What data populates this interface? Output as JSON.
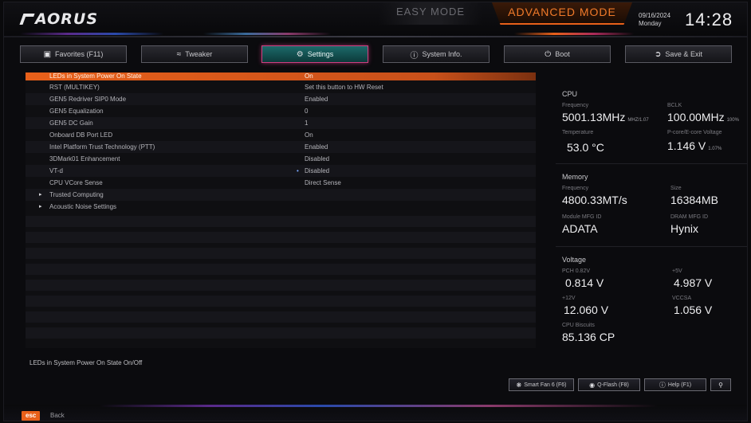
{
  "header": {
    "logo_text": "AORUS",
    "easy_mode": "EASY MODE",
    "advanced_mode": "ADVANCED MODE",
    "date": "09/16/2024",
    "day": "Monday",
    "time": "14:28"
  },
  "tabs": [
    {
      "label": "Favorites (F11)",
      "icon": "star-folder-icon"
    },
    {
      "label": "Tweaker",
      "icon": "tweaker-icon"
    },
    {
      "label": "Settings",
      "icon": "settings-gear-icon",
      "active": true
    },
    {
      "label": "System Info.",
      "icon": "info-icon"
    },
    {
      "label": "Boot",
      "icon": "power-icon"
    },
    {
      "label": "Save & Exit",
      "icon": "exit-arrow-icon"
    }
  ],
  "settings": [
    {
      "name": "LEDs in System Power On State",
      "value": "On",
      "selected": true
    },
    {
      "name": "RST (MULTIKEY)",
      "value": "Set this button to HW Reset"
    },
    {
      "name": "GEN5 Redriver SIP0 Mode",
      "value": "Enabled"
    },
    {
      "name": "GEN5 Equalization",
      "value": "0"
    },
    {
      "name": "GEN5 DC Gain",
      "value": "1"
    },
    {
      "name": "Onboard DB Port LED",
      "value": "On"
    },
    {
      "name": "Intel Platform Trust Technology (PTT)",
      "value": "Enabled"
    },
    {
      "name": "3DMark01 Enhancement",
      "value": "Disabled"
    },
    {
      "name": "VT-d",
      "value": "Disabled",
      "marker": "•"
    },
    {
      "name": "CPU VCore Sense",
      "value": "Direct Sense"
    },
    {
      "name": "Trusted Computing",
      "value": "",
      "submenu": "▸"
    },
    {
      "name": "Acoustic Noise Settings",
      "value": "",
      "submenu": "▸"
    }
  ],
  "help_text": "LEDs in System Power On State On/Off",
  "panel": {
    "cpu": {
      "title": "CPU",
      "freq_label": "Frequency",
      "freq": "5001.13MHz",
      "freq_unit": "MHZ/1.07",
      "bclk_label": "BCLK",
      "bclk": "100.00MHz",
      "bclk_unit": "100%",
      "temp_label": "Temperature",
      "temp": "53.0 °C",
      "volt_label": "P-core/E-core Voltage",
      "volt": "1.146 V",
      "volt_unit": "1.07%"
    },
    "memory": {
      "title": "Memory",
      "freq_label": "Frequency",
      "freq": "4800.33MT/s",
      "size_label": "Size",
      "size": "16384MB",
      "mfg_label": "Module MFG ID",
      "mfg": "ADATA",
      "dram_label": "DRAM MFG ID",
      "dram": "Hynix"
    },
    "voltage": {
      "title": "Voltage",
      "pch_label": "PCH 0.82V",
      "pch": "0.814 V",
      "v5_label": "+5V",
      "v5": "4.987 V",
      "v12_label": "+12V",
      "v12": "12.060 V",
      "vccsa_label": "VCCSA",
      "vccsa": "1.056 V",
      "bench_label": "CPU Biscuits",
      "bench": "85.136 CP"
    }
  },
  "bottom_buttons": [
    {
      "label": "Smart Fan 6 (F6)",
      "icon": "fan-icon"
    },
    {
      "label": "Q-Flash (F8)",
      "icon": "flash-icon"
    },
    {
      "label": "Help (F1)",
      "icon": "help-icon"
    },
    {
      "label": "",
      "icon": "search-icon"
    }
  ],
  "footer": {
    "esc": "esc",
    "back": "Back"
  },
  "colors": {
    "accent": "#e8601a",
    "active_tab": "#1c6a6a",
    "active_tab_border": "#d04080"
  }
}
